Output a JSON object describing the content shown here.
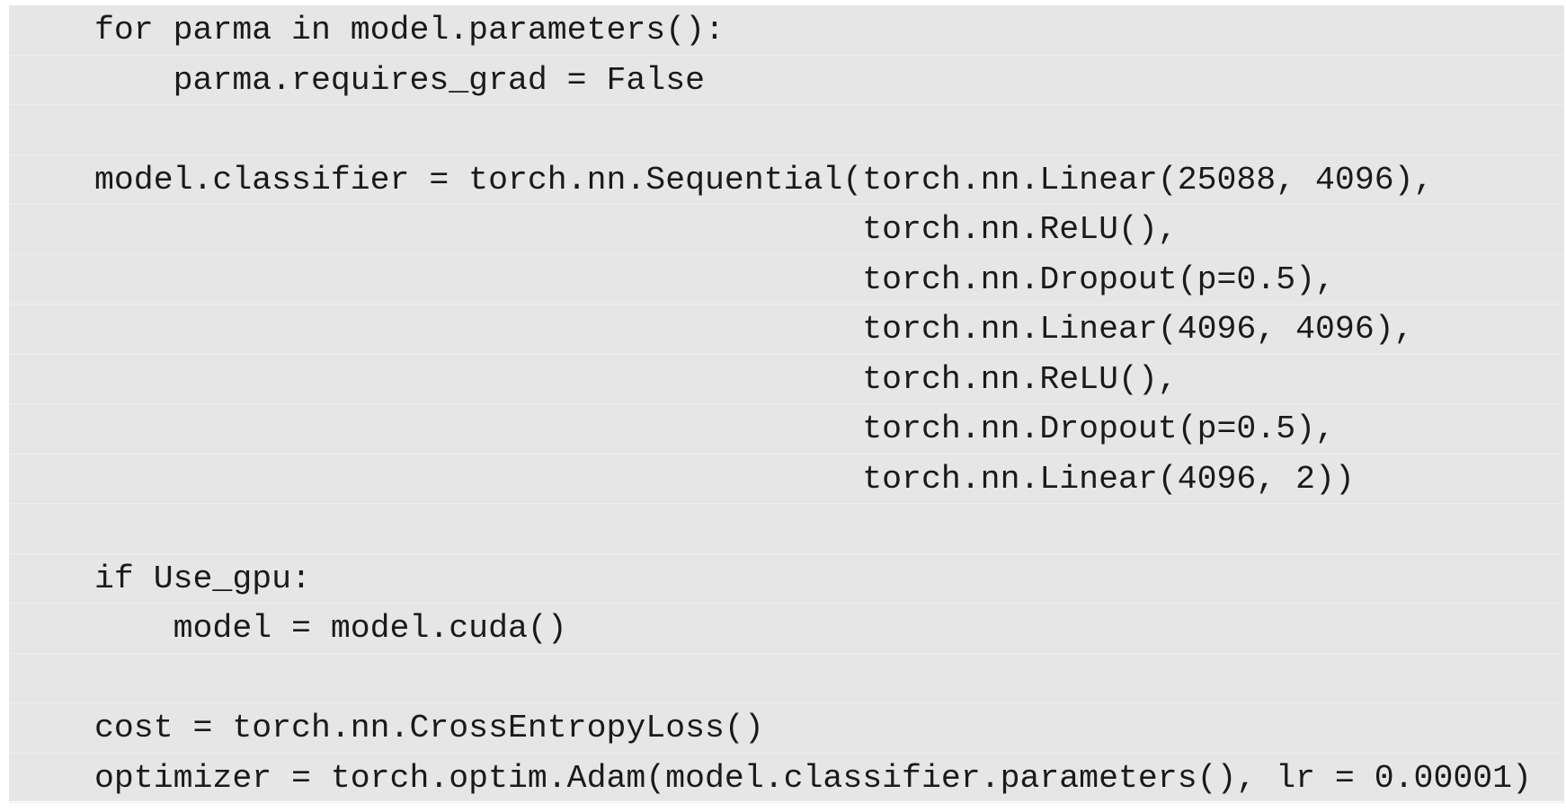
{
  "code": {
    "lines": [
      "for parma in model.parameters():",
      "    parma.requires_grad = False",
      "",
      "model.classifier = torch.nn.Sequential(torch.nn.Linear(25088, 4096),",
      "                                       torch.nn.ReLU(),",
      "                                       torch.nn.Dropout(p=0.5),",
      "                                       torch.nn.Linear(4096, 4096),",
      "                                       torch.nn.ReLU(),",
      "                                       torch.nn.Dropout(p=0.5),",
      "                                       torch.nn.Linear(4096, 2))",
      "",
      "if Use_gpu:",
      "    model = model.cuda()",
      "",
      "cost = torch.nn.CrossEntropyLoss()",
      "optimizer = torch.optim.Adam(model.classifier.parameters(), lr = 0.00001)"
    ]
  }
}
